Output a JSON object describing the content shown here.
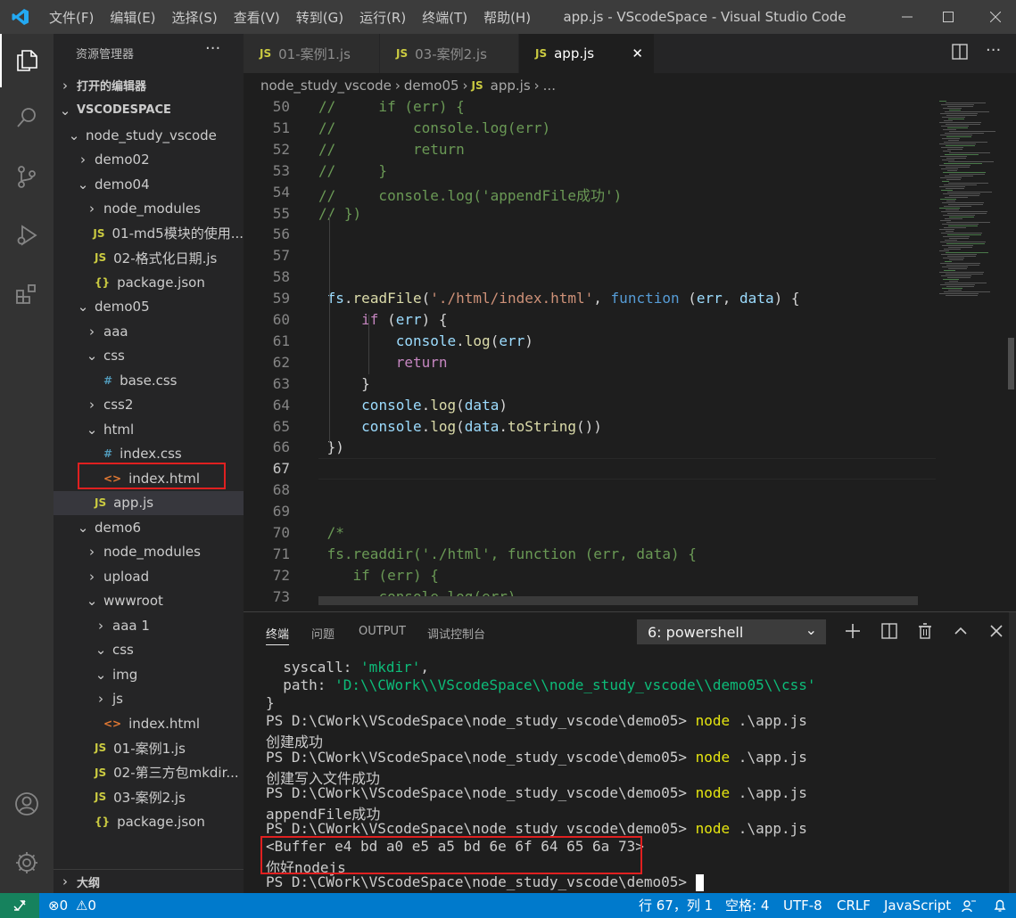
{
  "titlebar": {
    "menus": [
      "文件(F)",
      "编辑(E)",
      "选择(S)",
      "查看(V)",
      "转到(G)",
      "运行(R)",
      "终端(T)",
      "帮助(H)"
    ],
    "window_title": "app.js - VScodeSpace - Visual Studio Code"
  },
  "sidebar": {
    "title": "资源管理器",
    "open_editors": "打开的编辑器",
    "workspace": "VSCODESPACE",
    "outline": "大纲",
    "tree": [
      {
        "label": "node_study_vscode",
        "depth": 1,
        "twisty": "open"
      },
      {
        "label": "demo02",
        "depth": 2,
        "twisty": "closed"
      },
      {
        "label": "demo04",
        "depth": 2,
        "twisty": "open"
      },
      {
        "label": "node_modules",
        "depth": 3,
        "twisty": "closed"
      },
      {
        "label": "01-md5模块的使用...",
        "depth": 3,
        "icon": "JS"
      },
      {
        "label": "02-格式化日期.js",
        "depth": 3,
        "icon": "JS"
      },
      {
        "label": "package.json",
        "depth": 3,
        "icon": "{}"
      },
      {
        "label": "demo05",
        "depth": 2,
        "twisty": "open"
      },
      {
        "label": "aaa",
        "depth": 3,
        "twisty": "closed"
      },
      {
        "label": "css",
        "depth": 3,
        "twisty": "open"
      },
      {
        "label": "base.css",
        "depth": 4,
        "icon": "#"
      },
      {
        "label": "css2",
        "depth": 3,
        "twisty": "closed"
      },
      {
        "label": "html",
        "depth": 3,
        "twisty": "open"
      },
      {
        "label": "index.css",
        "depth": 4,
        "icon": "#"
      },
      {
        "label": "index.html",
        "depth": 4,
        "icon": "<>"
      },
      {
        "label": "app.js",
        "depth": 3,
        "icon": "JS",
        "selected": true
      },
      {
        "label": "demo6",
        "depth": 2,
        "twisty": "open"
      },
      {
        "label": "node_modules",
        "depth": 3,
        "twisty": "closed"
      },
      {
        "label": "upload",
        "depth": 3,
        "twisty": "closed"
      },
      {
        "label": "wwwroot",
        "depth": 3,
        "twisty": "open"
      },
      {
        "label": "aaa 1",
        "depth": 4,
        "twisty": "closed"
      },
      {
        "label": "css",
        "depth": 4,
        "twisty": "open"
      },
      {
        "label": "img",
        "depth": 4,
        "twisty": "open"
      },
      {
        "label": "js",
        "depth": 4,
        "twisty": "closed"
      },
      {
        "label": "index.html",
        "depth": 4,
        "icon": "<>"
      },
      {
        "label": "01-案例1.js",
        "depth": 3,
        "icon": "JS"
      },
      {
        "label": "02-第三方包mkdir...",
        "depth": 3,
        "icon": "JS"
      },
      {
        "label": "03-案例2.js",
        "depth": 3,
        "icon": "JS"
      },
      {
        "label": "package.json",
        "depth": 3,
        "icon": "{}"
      }
    ]
  },
  "tabs": [
    {
      "label": "01-案例1.js",
      "badge": "JS"
    },
    {
      "label": "03-案例2.js",
      "badge": "JS"
    },
    {
      "label": "app.js",
      "badge": "JS",
      "active": true,
      "close": "✕"
    }
  ],
  "breadcrumb": {
    "items": [
      "node_study_vscode",
      "demo05",
      "app.js",
      "..."
    ],
    "separator": "›"
  },
  "editor": {
    "current_line": 67,
    "lines": [
      {
        "n": "50",
        "t": [
          [
            "c",
            "//     if (err) {"
          ]
        ]
      },
      {
        "n": "51",
        "t": [
          [
            "c",
            "//         console.log(err)"
          ]
        ]
      },
      {
        "n": "52",
        "t": [
          [
            "c",
            "//         return"
          ]
        ]
      },
      {
        "n": "53",
        "t": [
          [
            "c",
            "//     }"
          ]
        ]
      },
      {
        "n": "54",
        "t": [
          [
            "c",
            "//     console.log('appendFile成功')"
          ]
        ]
      },
      {
        "n": "55",
        "t": [
          [
            "c",
            "// })"
          ]
        ]
      },
      {
        "n": "56",
        "t": []
      },
      {
        "n": "57",
        "t": []
      },
      {
        "n": "58",
        "t": []
      },
      {
        "n": "59",
        "t": [
          [
            "p",
            " "
          ],
          [
            "v",
            "fs"
          ],
          [
            "p",
            "."
          ],
          [
            "f",
            "readFile"
          ],
          [
            "p",
            "("
          ],
          [
            "s",
            "'./html/index.html'"
          ],
          [
            "p",
            ", "
          ],
          [
            "k",
            "function"
          ],
          [
            "p",
            " ("
          ],
          [
            "v",
            "err"
          ],
          [
            "p",
            ", "
          ],
          [
            "v",
            "data"
          ],
          [
            "p",
            ") {"
          ]
        ]
      },
      {
        "n": "60",
        "t": [
          [
            "p",
            "     "
          ],
          [
            "ctl",
            "if"
          ],
          [
            "p",
            " ("
          ],
          [
            "v",
            "err"
          ],
          [
            "p",
            ") {"
          ]
        ]
      },
      {
        "n": "61",
        "t": [
          [
            "p",
            "         "
          ],
          [
            "v",
            "console"
          ],
          [
            "p",
            "."
          ],
          [
            "f",
            "log"
          ],
          [
            "p",
            "("
          ],
          [
            "v",
            "err"
          ],
          [
            "p",
            ")"
          ]
        ]
      },
      {
        "n": "62",
        "t": [
          [
            "p",
            "         "
          ],
          [
            "ctl",
            "return"
          ]
        ]
      },
      {
        "n": "63",
        "t": [
          [
            "p",
            "     }"
          ]
        ]
      },
      {
        "n": "64",
        "t": [
          [
            "p",
            "     "
          ],
          [
            "v",
            "console"
          ],
          [
            "p",
            "."
          ],
          [
            "f",
            "log"
          ],
          [
            "p",
            "("
          ],
          [
            "v",
            "data"
          ],
          [
            "p",
            ")"
          ]
        ]
      },
      {
        "n": "65",
        "t": [
          [
            "p",
            "     "
          ],
          [
            "v",
            "console"
          ],
          [
            "p",
            "."
          ],
          [
            "f",
            "log"
          ],
          [
            "p",
            "("
          ],
          [
            "v",
            "data"
          ],
          [
            "p",
            "."
          ],
          [
            "f",
            "toString"
          ],
          [
            "p",
            "())"
          ]
        ]
      },
      {
        "n": "66",
        "t": [
          [
            "p",
            " })"
          ]
        ]
      },
      {
        "n": "67",
        "t": []
      },
      {
        "n": "68",
        "t": []
      },
      {
        "n": "69",
        "t": []
      },
      {
        "n": "70",
        "t": [
          [
            "c",
            " /*"
          ]
        ]
      },
      {
        "n": "71",
        "t": [
          [
            "c",
            " fs.readdir('./html', function (err, data) {"
          ]
        ]
      },
      {
        "n": "72",
        "t": [
          [
            "c",
            "    if (err) {"
          ]
        ]
      },
      {
        "n": "73",
        "t": [
          [
            "c",
            "       console.log(err)"
          ]
        ]
      }
    ]
  },
  "panel": {
    "tabs": [
      "终端",
      "问题",
      "OUTPUT",
      "调试控制台"
    ],
    "active_tab": "终端",
    "terminal_select": "6: powershell",
    "lines": [
      [
        [
          "p",
          "  syscall: "
        ],
        [
          "g",
          "'mkdir'"
        ],
        [
          "p",
          ","
        ]
      ],
      [
        [
          "p",
          "  path: "
        ],
        [
          "g",
          "'D:\\\\CWork\\\\VScodeSpace\\\\node_study_vscode\\\\demo05\\\\css'"
        ]
      ],
      [
        [
          "p",
          "}"
        ]
      ],
      [
        [
          "p",
          "PS D:\\CWork\\VScodeSpace\\node_study_vscode\\demo05> "
        ],
        [
          "y",
          "node"
        ],
        [
          "p",
          " .\\app.js"
        ]
      ],
      [
        [
          "cn",
          "创建成功"
        ]
      ],
      [
        [
          "p",
          "PS D:\\CWork\\VScodeSpace\\node_study_vscode\\demo05> "
        ],
        [
          "y",
          "node"
        ],
        [
          "p",
          " .\\app.js"
        ]
      ],
      [
        [
          "cn",
          "创建写入文件成功"
        ]
      ],
      [
        [
          "p",
          "PS D:\\CWork\\VScodeSpace\\node_study_vscode\\demo05> "
        ],
        [
          "y",
          "node"
        ],
        [
          "p",
          " .\\app.js"
        ]
      ],
      [
        [
          "p",
          "appendFile"
        ],
        [
          "cn",
          "成功"
        ]
      ],
      [
        [
          "p",
          "PS D:\\CWork\\VScodeSpace\\node_study_vscode\\demo05> "
        ],
        [
          "y",
          "node"
        ],
        [
          "p",
          " .\\app.js"
        ]
      ],
      [
        [
          "p",
          "<Buffer e4 bd a0 e5 a5 bd 6e 6f 64 65 6a 73>"
        ]
      ],
      [
        [
          "cn",
          "你好"
        ],
        [
          "p",
          "nodejs"
        ]
      ],
      [
        [
          "p",
          "PS D:\\CWork\\VScodeSpace\\node_study_vscode\\demo05> "
        ],
        [
          "cursor",
          " "
        ]
      ]
    ]
  },
  "statusbar": {
    "problems": "0",
    "warnings": "0",
    "position": "行 67，列 1",
    "spaces": "空格: 4",
    "encoding": "UTF-8",
    "eol": "CRLF",
    "language": "JavaScript"
  },
  "colors": {
    "accent": "#007acc",
    "highlight_box": "#e02020"
  }
}
